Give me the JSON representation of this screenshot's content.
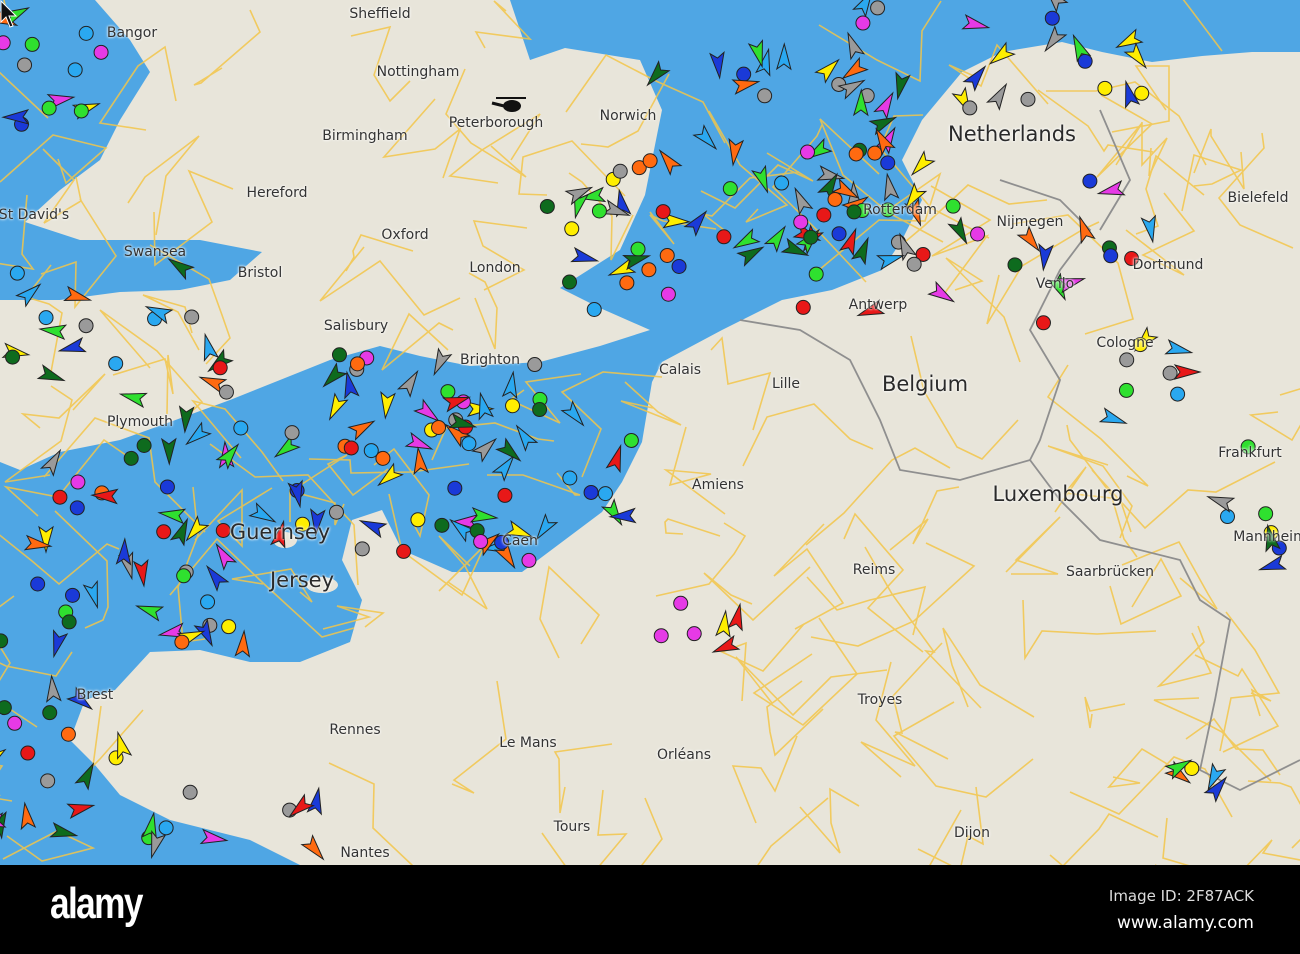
{
  "map": {
    "colors": {
      "sea": "#4fa6e4",
      "land": "#e8e5da",
      "road": "#f3c64a",
      "border": "#9a9a9a"
    },
    "ship_colors": [
      "#ffee00",
      "#2aa8f0",
      "#e63ae6",
      "#ff6a10",
      "#1a3ad8",
      "#2fe02f",
      "#0e6b1e",
      "#9a9a9a",
      "#e81818"
    ],
    "labels": {
      "sheffield": "Sheffield",
      "nottingham": "Nottingham",
      "bangor": "Bangor",
      "peterborough": "Peterborough",
      "norwich": "Norwich",
      "birmingham": "Birmingham",
      "hereford": "Hereford",
      "netherlands": "Netherlands",
      "bielefeld": "Bielefeld",
      "st_davids": "St David's",
      "oxford": "Oxford",
      "swansea": "Swansea",
      "bristol": "Bristol",
      "london": "London",
      "rotterdam": "Rotterdam",
      "nijmegen": "Nijmegen",
      "dortmund": "Dortmund",
      "venlo": "Venlo",
      "salisbury": "Salisbury",
      "brighton": "Brighton",
      "calais": "Calais",
      "antwerp": "Antwerp",
      "lille": "Lille",
      "belgium": "Belgium",
      "cologne": "Cologne",
      "plymouth": "Plymouth",
      "frankfurt": "Frankfurt",
      "amiens": "Amiens",
      "luxembourg": "Luxembourg",
      "guernsey": "Guernsey",
      "mannheim": "Mannheim",
      "reims": "Reims",
      "saarbrucken": "Saarbrücken",
      "jersey": "Jersey",
      "caen": "Caen",
      "brest": "Brest",
      "troyes": "Troyes",
      "rennes": "Rennes",
      "le_mans": "Le Mans",
      "orleans": "Orléans",
      "tours": "Tours",
      "dijon": "Dijon",
      "nantes": "Nantes"
    }
  },
  "watermark": {
    "logo": "alamy",
    "image_id": "Image ID: 2F87ACK",
    "site": "www.alamy.com"
  }
}
